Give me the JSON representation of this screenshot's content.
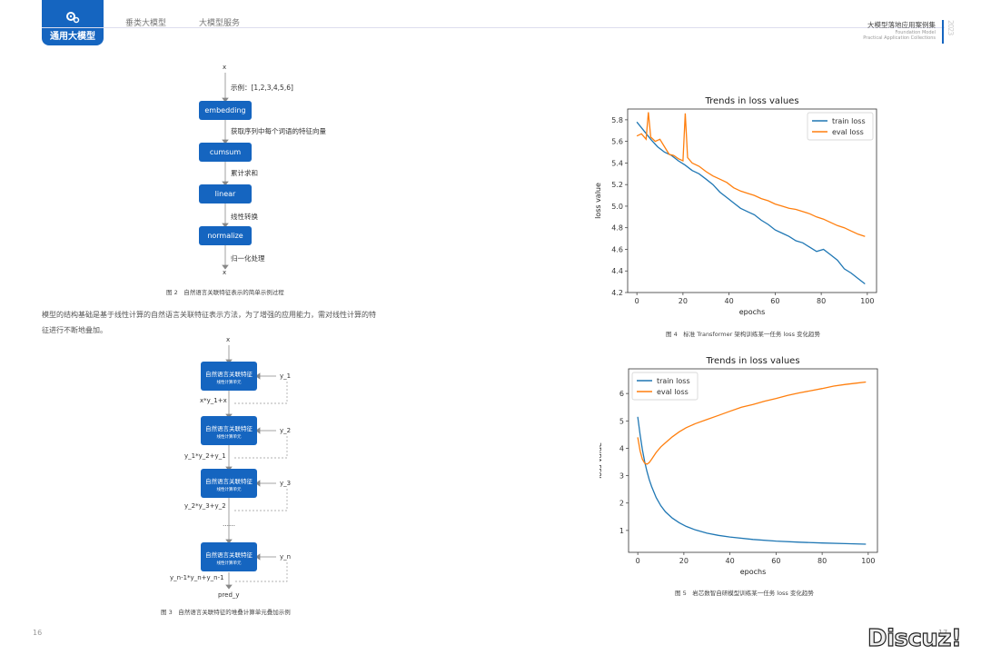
{
  "header": {
    "active_tab": "通用大模型",
    "tabs": [
      "垂类大模型",
      "大模型服务"
    ],
    "brand_title": "大模型落地应用案例集",
    "brand_sub1": "Foundation Model",
    "brand_sub2": "Practical Application Collections",
    "brand_year": "2023"
  },
  "figure2": {
    "x_top": "x",
    "note1": "示例：[1,2,3,4,5,6]",
    "boxes": [
      "embedding",
      "cumsum",
      "linear",
      "normalize"
    ],
    "notes": [
      "获取序列中每个词语的特征向量",
      "累计求和",
      "线性转换",
      "归一化处理"
    ],
    "x_bottom": "x",
    "caption": "图 2　自然语言关联特征表示的简单示例过程"
  },
  "paragraph": {
    "line1": "模型的结构基础是基于线性计算的自然语言关联特征表示方法，为了增强的应用能力，需对线性计算的特",
    "line2": "征进行不断地叠加。"
  },
  "figure3": {
    "x_top": "x",
    "unit_title": "自然语言关联特征",
    "unit_sub": "线性计算单元",
    "side": [
      "y_1",
      "y_2",
      "y_3",
      "y_n"
    ],
    "mid": [
      "x*y_1+x",
      "y_1*y_2+y_1",
      "y_2*y_3+y_2",
      "……",
      "y_n-1*y_n+y_n-1"
    ],
    "bottom": "pred_y",
    "caption": "图 3　自然语言关联特征的堆叠计算单元叠加示例"
  },
  "figure4": {
    "caption": "图 4　标准 Transformer 架构训练某一任务 loss 变化趋势"
  },
  "figure5": {
    "caption": "图 5　岩芯数智自研模型训练某一任务 loss 变化趋势"
  },
  "page_left": "16",
  "page_right": "17",
  "watermark": "Discuz!",
  "colors": {
    "accent": "#1565c0",
    "train": "#1f77b4",
    "eval": "#ff7f0e"
  },
  "chart_data": [
    {
      "type": "line",
      "title": "Trends in loss values",
      "xlabel": "epochs",
      "ylabel": "loss value",
      "xlim": [
        -4,
        104
      ],
      "ylim": [
        4.2,
        5.9
      ],
      "xticks": [
        0,
        20,
        40,
        60,
        80,
        100
      ],
      "yticks": [
        4.2,
        4.4,
        4.6,
        4.8,
        5.0,
        5.2,
        5.4,
        5.6,
        5.8
      ],
      "legend": "top-right",
      "series": [
        {
          "name": "train loss",
          "x": [
            0,
            3,
            6,
            9,
            12,
            15,
            18,
            21,
            24,
            27,
            30,
            33,
            36,
            39,
            42,
            45,
            48,
            51,
            54,
            57,
            60,
            63,
            66,
            69,
            72,
            75,
            78,
            81,
            84,
            87,
            90,
            93,
            96,
            99
          ],
          "values": [
            5.78,
            5.7,
            5.62,
            5.55,
            5.5,
            5.47,
            5.42,
            5.38,
            5.33,
            5.3,
            5.25,
            5.2,
            5.13,
            5.08,
            5.03,
            4.98,
            4.95,
            4.92,
            4.87,
            4.83,
            4.78,
            4.75,
            4.72,
            4.68,
            4.66,
            4.62,
            4.58,
            4.6,
            4.55,
            4.5,
            4.42,
            4.38,
            4.33,
            4.28
          ]
        },
        {
          "name": "eval loss",
          "x": [
            0,
            2,
            4,
            5,
            6,
            8,
            10,
            12,
            14,
            16,
            18,
            20,
            21,
            22,
            24,
            27,
            30,
            33,
            36,
            39,
            42,
            45,
            48,
            51,
            54,
            57,
            60,
            63,
            66,
            69,
            72,
            75,
            78,
            81,
            84,
            87,
            90,
            93,
            96,
            99
          ],
          "values": [
            5.65,
            5.67,
            5.62,
            5.87,
            5.64,
            5.6,
            5.62,
            5.55,
            5.48,
            5.47,
            5.44,
            5.42,
            5.86,
            5.45,
            5.4,
            5.37,
            5.32,
            5.28,
            5.25,
            5.22,
            5.17,
            5.14,
            5.12,
            5.1,
            5.07,
            5.05,
            5.02,
            5.0,
            4.98,
            4.97,
            4.95,
            4.93,
            4.9,
            4.88,
            4.85,
            4.82,
            4.8,
            4.77,
            4.74,
            4.72
          ]
        }
      ]
    },
    {
      "type": "line",
      "title": "Trends in loss values",
      "xlabel": "epochs",
      "ylabel": "loss value",
      "xlim": [
        -4,
        104
      ],
      "ylim": [
        0.2,
        6.9
      ],
      "xticks": [
        0,
        20,
        40,
        60,
        80,
        100
      ],
      "yticks": [
        1,
        2,
        3,
        4,
        5,
        6
      ],
      "legend": "top-left",
      "series": [
        {
          "name": "train loss",
          "x": [
            0,
            1,
            2,
            3,
            4,
            5,
            6,
            8,
            10,
            12,
            15,
            18,
            21,
            25,
            30,
            35,
            40,
            50,
            60,
            70,
            80,
            90,
            99
          ],
          "values": [
            5.15,
            4.5,
            3.95,
            3.5,
            3.15,
            2.85,
            2.6,
            2.2,
            1.9,
            1.68,
            1.45,
            1.28,
            1.15,
            1.02,
            0.9,
            0.82,
            0.76,
            0.67,
            0.61,
            0.57,
            0.54,
            0.52,
            0.5
          ]
        },
        {
          "name": "eval loss",
          "x": [
            0,
            1,
            2,
            3,
            4,
            5,
            6,
            8,
            10,
            12,
            15,
            18,
            21,
            25,
            30,
            35,
            40,
            45,
            50,
            55,
            60,
            65,
            70,
            75,
            80,
            85,
            90,
            95,
            99
          ],
          "values": [
            4.4,
            3.9,
            3.6,
            3.45,
            3.42,
            3.48,
            3.6,
            3.85,
            4.05,
            4.2,
            4.42,
            4.6,
            4.75,
            4.9,
            5.05,
            5.2,
            5.35,
            5.5,
            5.6,
            5.72,
            5.82,
            5.93,
            6.02,
            6.1,
            6.18,
            6.27,
            6.33,
            6.38,
            6.42
          ]
        }
      ]
    }
  ]
}
